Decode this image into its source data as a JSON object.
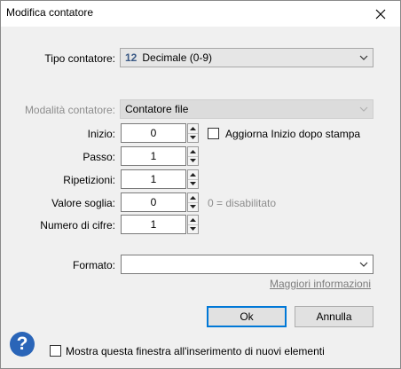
{
  "window": {
    "title": "Modifica contatore"
  },
  "tipo": {
    "label": "Tipo contatore:",
    "icon_text": "12",
    "value": "Decimale (0-9)"
  },
  "modalita": {
    "label": "Modalità contatore:",
    "value": "Contatore file"
  },
  "fields": [
    {
      "label": "Inizio:",
      "value": "0"
    },
    {
      "label": "Passo:",
      "value": "1"
    },
    {
      "label": "Ripetizioni:",
      "value": "1"
    },
    {
      "label": "Valore soglia:",
      "value": "0"
    },
    {
      "label": "Numero di cifre:",
      "value": "1"
    }
  ],
  "aggiorna": {
    "label": "Aggiorna Inizio dopo stampa",
    "checked": false
  },
  "soglia_hint": "0 = disabilitato",
  "formato": {
    "label": "Formato:",
    "value": ""
  },
  "more_info": "Maggiori informazioni",
  "buttons": {
    "ok": "Ok",
    "cancel": "Annulla"
  },
  "mostra": {
    "label": "Mostra questa finestra all'inserimento di nuovi elementi",
    "checked": false
  },
  "help_icon": "?",
  "icons": {
    "close": "close-icon",
    "help": "help-icon",
    "dropdown": "chevron-down-icon",
    "spin_up": "triangle-up-icon",
    "spin_down": "triangle-down-icon"
  },
  "colors": {
    "accent": "#0078d7",
    "help": "#2a65b8",
    "disabled_text": "#8d8d8d"
  }
}
